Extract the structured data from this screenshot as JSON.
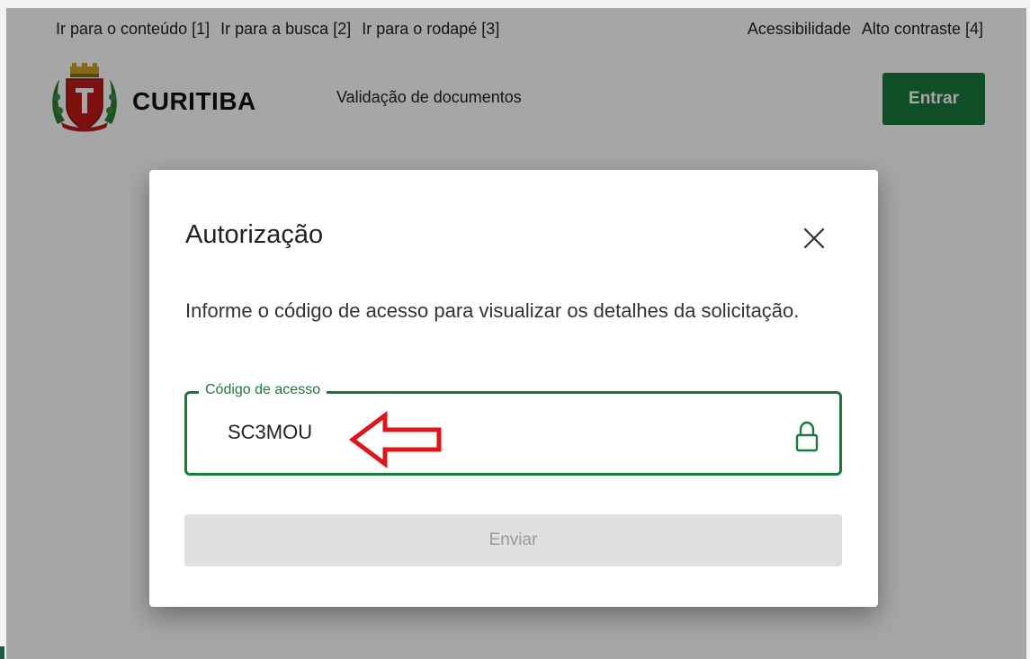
{
  "skip_links": {
    "content": "Ir para o conteúdo [1]",
    "search": "Ir para a busca [2]",
    "footer": "Ir para o rodapé [3]"
  },
  "accessibility_links": {
    "accessibility": "Acessibilidade",
    "high_contrast": "Alto contraste [4]"
  },
  "header": {
    "brand": "CURITIBA",
    "logo_icon": "curitiba-coat-of-arms",
    "nav_title": "Validação de documentos",
    "login_label": "Entrar"
  },
  "modal": {
    "title": "Autorização",
    "close_icon": "close-icon",
    "description": "Informe o código de acesso para visualizar os detalhes da solicitação.",
    "field": {
      "label": "Código de acesso",
      "value": "SC3MOU",
      "icon": "lock-icon"
    },
    "submit_label": "Enviar"
  },
  "colors": {
    "brand_green": "#1a7a3b",
    "annotation_red": "#e0141b",
    "overlay": "#a5a7a6"
  }
}
